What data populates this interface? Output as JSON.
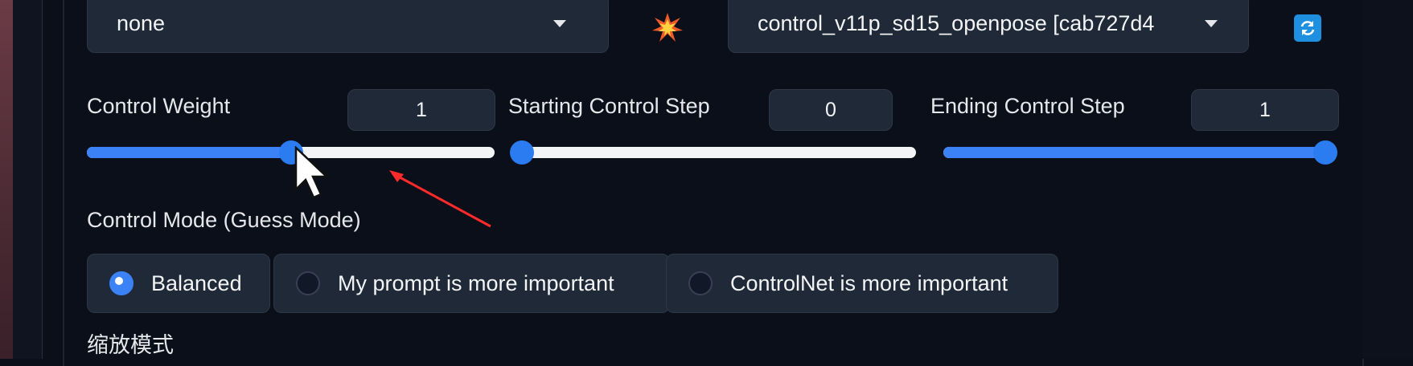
{
  "preprocessor": {
    "value": "none"
  },
  "model": {
    "value": "control_v11p_sd15_openpose [cab727d4"
  },
  "icons": {
    "run_preprocessor": "explosion-icon",
    "refresh": "refresh-icon"
  },
  "sliders": {
    "control_weight": {
      "label": "Control Weight",
      "value": "1",
      "fraction": 0.5
    },
    "starting_step": {
      "label": "Starting Control Step",
      "value": "0",
      "fraction": 0.0
    },
    "ending_step": {
      "label": "Ending Control Step",
      "value": "1",
      "fraction": 1.0
    }
  },
  "control_mode": {
    "label": "Control Mode (Guess Mode)",
    "options": [
      {
        "label": "Balanced",
        "selected": true
      },
      {
        "label": "My prompt is more important",
        "selected": false
      },
      {
        "label": "ControlNet is more important",
        "selected": false
      }
    ]
  },
  "resize_mode": {
    "label": "缩放模式"
  },
  "colors": {
    "accent": "#3b82f6",
    "panel": "#1f2937",
    "background": "#0b0f19",
    "annotation_arrow": "#ff2a2a"
  }
}
